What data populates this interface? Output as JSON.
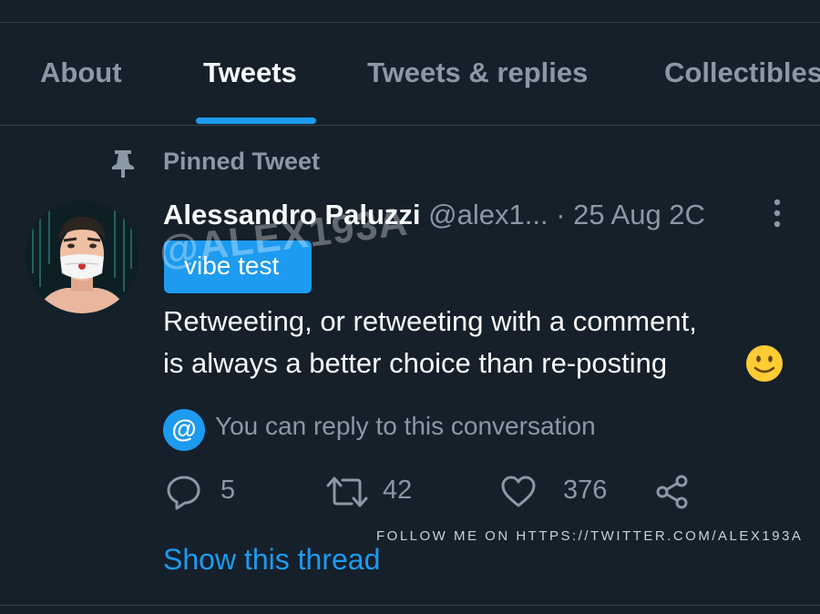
{
  "tabs": [
    {
      "label": "About",
      "active": false
    },
    {
      "label": "Tweets",
      "active": true
    },
    {
      "label": "Tweets & replies",
      "active": false
    },
    {
      "label": "Collectibles",
      "active": false
    }
  ],
  "pinned": {
    "label": "Pinned Tweet",
    "icon": "pin-icon"
  },
  "tweet": {
    "author_name": "Alessandro Paluzzi",
    "handle": "@alex1...",
    "separator": "·",
    "date": "25 Aug 2C",
    "tag": "vibe test",
    "watermark": "@ALEX193A",
    "text_line1": "Retweeting, or retweeting with a comment,",
    "text_line2": "is always a better choice than re-posting",
    "emoji": "slightly-smiling-face-icon",
    "reply_notice": "You can reply to this conversation",
    "reply_badge": "@",
    "actions": {
      "replies": "5",
      "retweets": "42",
      "likes": "376"
    },
    "show_thread": "Show this thread"
  },
  "follow_banner": "FOLLOW ME ON HTTPS://TWITTER.COM/ALEX193A",
  "colors": {
    "background": "#15202b",
    "accent": "#1d9bf0",
    "secondary_text": "#8b98a5",
    "primary_text": "#f7f9f9"
  }
}
